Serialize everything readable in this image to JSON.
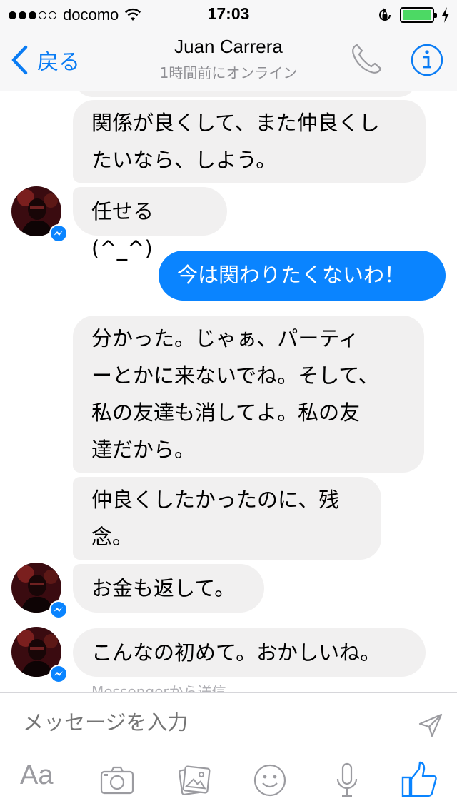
{
  "status_bar": {
    "carrier": "docomo",
    "time": "17:03",
    "signal_bars": 3,
    "signal_total": 5,
    "battery_level": 1.0,
    "icons": [
      "wifi-icon",
      "rotation-lock-icon",
      "battery-icon",
      "charging-bolt-icon"
    ]
  },
  "nav": {
    "back_label": "戻る",
    "title": "Juan Carrera",
    "subtitle": "1時間前にオンライン",
    "icons": [
      "back-chevron-icon",
      "phone-icon",
      "info-icon"
    ],
    "accent_color": "#0a7cf4"
  },
  "messages": [
    {
      "sender": "them",
      "lines": [
        "関係が良くして、また仲良くし",
        "たいなら、しよう。"
      ]
    },
    {
      "sender": "them",
      "lines": [
        "任せる(^_^)"
      ],
      "avatar": true
    },
    {
      "sender": "me",
      "lines": [
        "今は関わりたくないわ！"
      ]
    },
    {
      "sender": "them",
      "lines": [
        "分かった。じゃぁ、パーティ",
        "ーとかに来ないでね。そして、",
        "私の友達も消してよ。私の友",
        "達だから。"
      ]
    },
    {
      "sender": "them",
      "lines": [
        "仲良くしたかったのに、残",
        "念。"
      ]
    },
    {
      "sender": "them",
      "lines": [
        "お金も返して。"
      ],
      "avatar": true
    },
    {
      "sender": "them",
      "lines": [
        "こんなの初めて。おかしいね。"
      ],
      "avatar": true
    }
  ],
  "footer_note": "Messengerから送信",
  "colors": {
    "incoming_bubble": "#f1f0f0",
    "outgoing_bubble": "#0a84ff"
  },
  "composer": {
    "placeholder": "メッセージを入力",
    "aa_label": "Aa",
    "tools": [
      "camera-icon",
      "photo-gallery-icon",
      "emoji-icon",
      "microphone-icon",
      "like-thumbs-up-icon"
    ],
    "send_icon": "send-arrow-icon"
  }
}
